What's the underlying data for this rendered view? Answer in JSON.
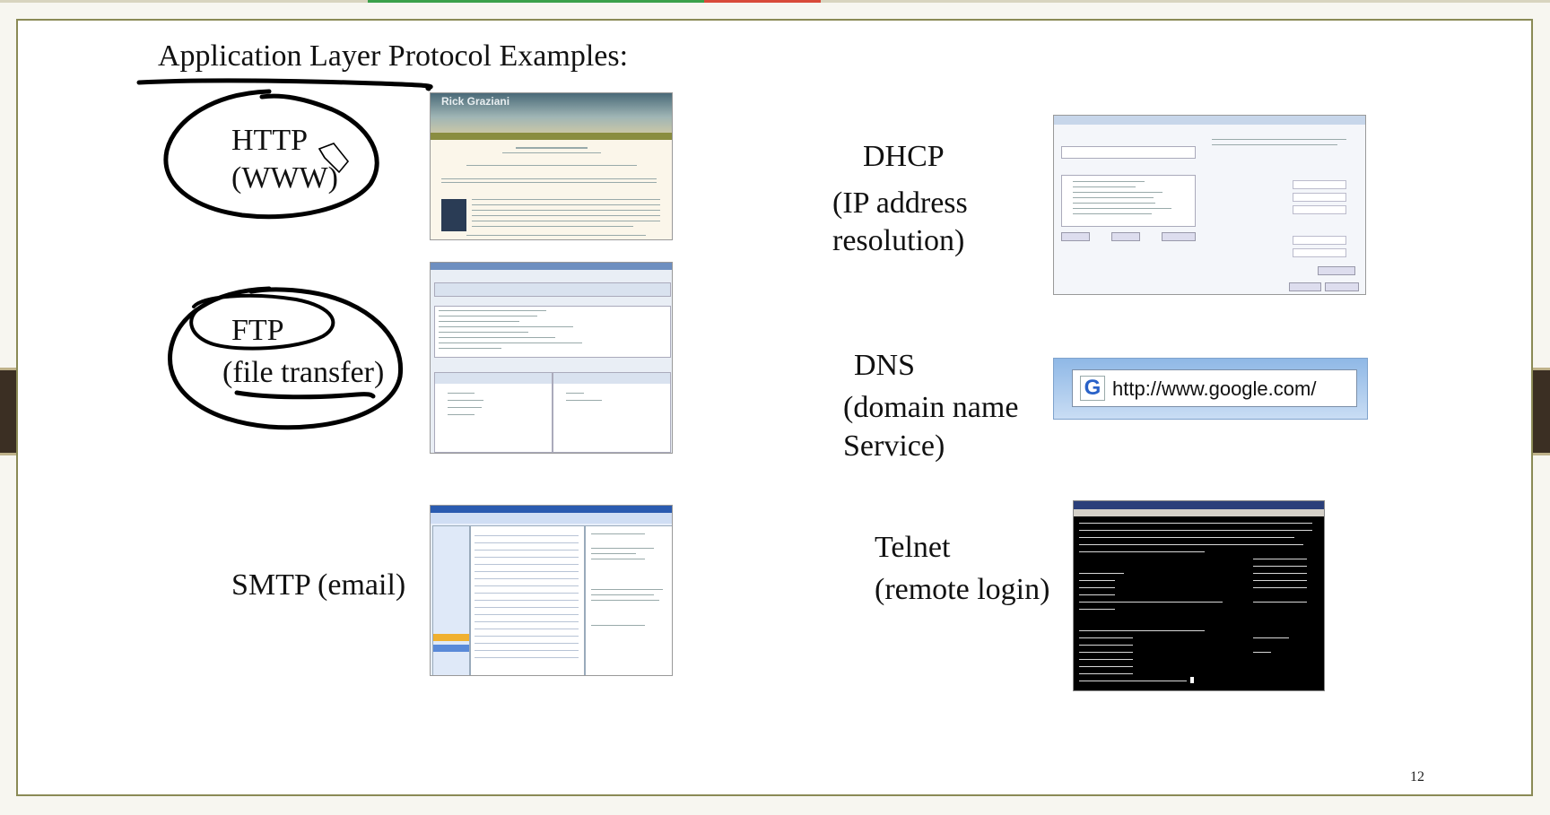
{
  "slide": {
    "title": "Application Layer Protocol Examples:",
    "page_number": "12",
    "protocols": {
      "http": {
        "name": "HTTP",
        "desc": "(WWW)"
      },
      "ftp": {
        "name": "FTP",
        "desc": "(file transfer)"
      },
      "smtp": {
        "name": "SMTP (email)"
      },
      "dhcp": {
        "name": "DHCP",
        "desc1": "(IP address",
        "desc2": "resolution)"
      },
      "dns": {
        "name": "DNS",
        "desc1": "(domain name",
        "desc2": "Service)"
      },
      "telnet": {
        "name": "Telnet",
        "desc": "(remote login)"
      }
    },
    "screenshots": {
      "http_page": {
        "header": "Rick Graziani"
      },
      "dns_browser": {
        "url": "http://www.google.com/"
      }
    }
  },
  "colors": {
    "slide_border": "#8a8a55",
    "side_tab": "#3b2f23",
    "ink": "#000000"
  }
}
